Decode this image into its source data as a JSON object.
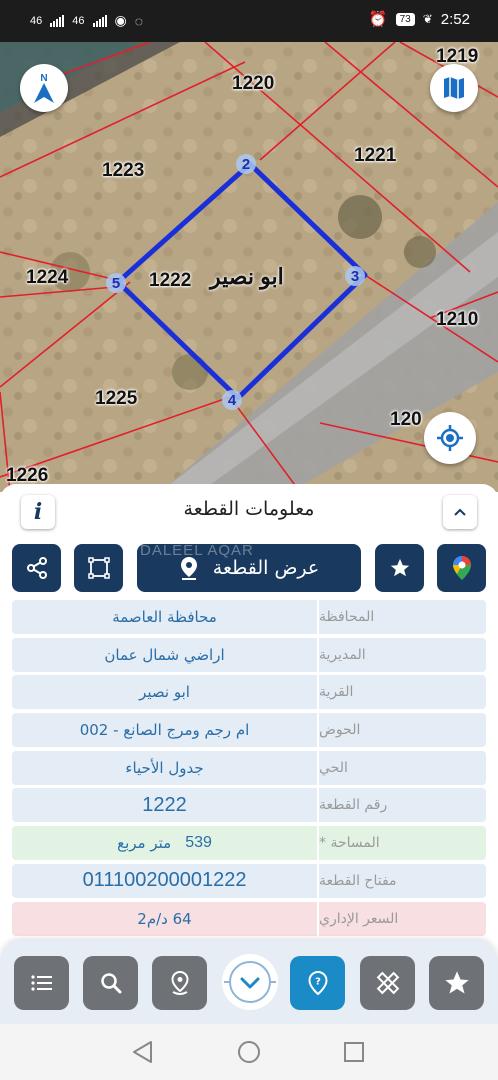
{
  "status_bar": {
    "sim1": "46",
    "sim2": "46",
    "battery": "73",
    "time": "2:52"
  },
  "map": {
    "parcels": [
      "1219",
      "1220",
      "1221",
      "1223",
      "1224",
      "1222",
      "1210",
      "1225",
      "120",
      "1226"
    ],
    "village_label": "ابو نصير",
    "vertices": [
      "2",
      "3",
      "4",
      "5"
    ]
  },
  "panel": {
    "title": "معلومات القطعة",
    "show_parcel_label": "عرض القطعة",
    "watermark": "DALEEL AQAR",
    "rows": [
      {
        "label": "المحافظة",
        "value": "محافظة العاصمة"
      },
      {
        "label": "المديرية",
        "value": "اراضي شمال عمان"
      },
      {
        "label": "القرية",
        "value": "ابو نصير"
      },
      {
        "label": "الحوض",
        "value": "ام رجم ومرج الصانع - 002"
      },
      {
        "label": "الحي",
        "value": "جدول الأحياء"
      },
      {
        "label": "رقم القطعة",
        "value": "1222"
      },
      {
        "label": "المساحة *",
        "value": "539",
        "unit": "متر مربع"
      },
      {
        "label": "مفتاح القطعة",
        "value": "011100200001222"
      },
      {
        "label": "السعر الإداري",
        "value": "64 د/م2"
      }
    ]
  },
  "icons": {
    "info": "i",
    "map_pin_color": "#e84335",
    "accent": "#193a5e",
    "active_nav": "#1a8bc7"
  }
}
